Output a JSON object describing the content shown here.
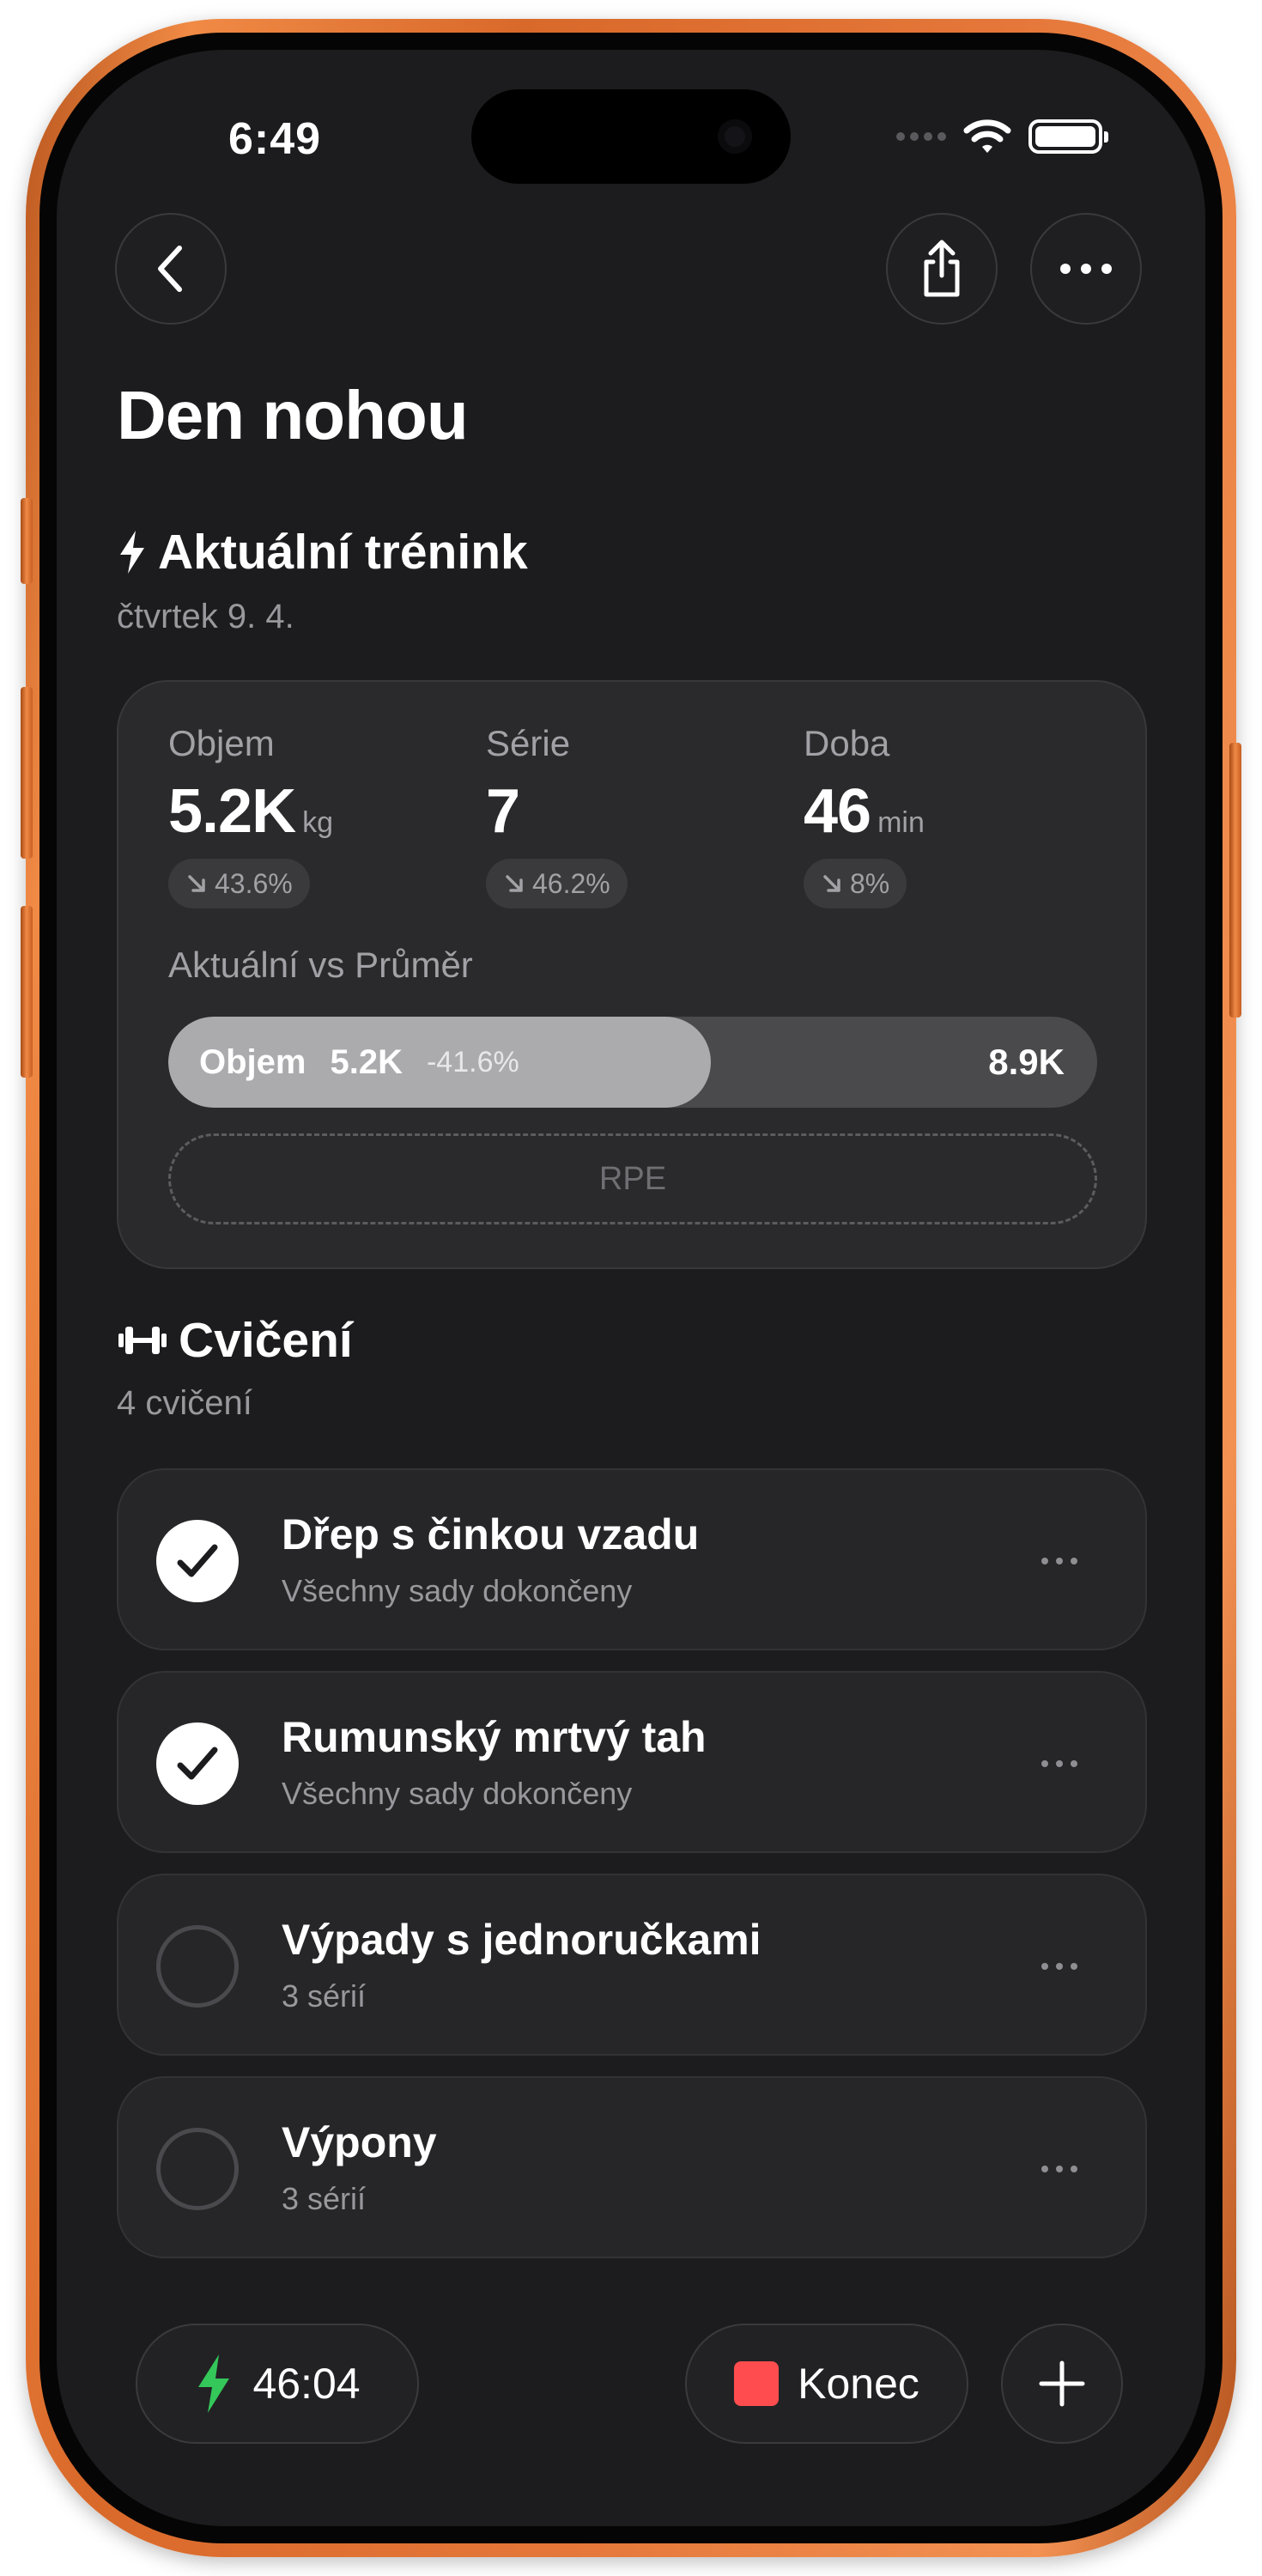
{
  "status_bar": {
    "time": "6:49"
  },
  "header": {
    "title": "Den nohou"
  },
  "current_workout": {
    "title": "Aktuální trénink",
    "date": "čtvrtek 9. 4.",
    "stats": [
      {
        "label": "Objem",
        "value": "5.2K",
        "unit": "kg",
        "change": "43.6%"
      },
      {
        "label": "Série",
        "value": "7",
        "unit": "",
        "change": "46.2%"
      },
      {
        "label": "Doba",
        "value": "46",
        "unit": "min",
        "change": "8%"
      }
    ],
    "comparison": {
      "label": "Aktuální vs Průměr",
      "metric": "Objem",
      "current": "5.2K",
      "diff": "-41.6%",
      "average": "8.9K",
      "fill_fraction": 0.584
    },
    "rpe_label": "RPE"
  },
  "exercises": {
    "title": "Cvičení",
    "count_label": "4 cvičení",
    "items": [
      {
        "name": "Dřep s činkou vzadu",
        "subtitle": "Všechny sady dokončeny",
        "done": true
      },
      {
        "name": "Rumunský mrtvý tah",
        "subtitle": "Všechny sady dokončeny",
        "done": true
      },
      {
        "name": "Výpady s jednoručkami",
        "subtitle": "3 sérií",
        "done": false
      },
      {
        "name": "Výpony",
        "subtitle": "3 sérií",
        "done": false
      }
    ]
  },
  "bottom_bar": {
    "timer": "46:04",
    "end_label": "Konec"
  },
  "colors": {
    "accent_green": "#34c759",
    "stop_red": "#ff4d4f",
    "card_bg": "#2a2a2c",
    "screen_bg": "#1c1c1e"
  },
  "icons": {
    "back": "chevron-left-icon",
    "share": "share-icon",
    "more": "ellipsis-icon",
    "workout": "bolt-icon",
    "exercises": "dumbbell-icon",
    "add": "plus-icon"
  }
}
